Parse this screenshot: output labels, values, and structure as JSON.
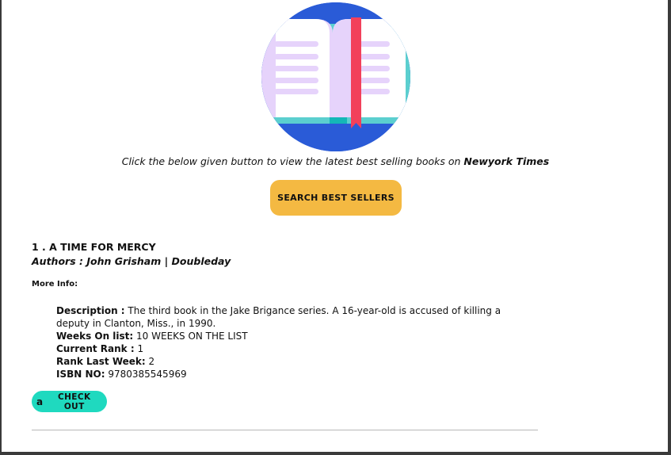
{
  "hero": {
    "icon": "open-book-icon"
  },
  "tagline": {
    "text": "Click the below given button to view the latest best selling books on ",
    "source": "Newyork Times"
  },
  "search_button": {
    "label": "SEARCH BEST SELLERS"
  },
  "books": [
    {
      "title": "1 . A TIME FOR MERCY",
      "authors": "Authors : John Grisham | Doubleday",
      "more_info_label": "More Info:",
      "description_label": "Description :",
      "description": " The third book in the Jake Brigance series. A 16-year-old is accused of killing a deputy in Clanton, Miss., in 1990.",
      "weeks_label": "Weeks On list:",
      "weeks": " 10 WEEKS ON THE LIST",
      "rank_label": "Current Rank :",
      "rank": " 1",
      "last_week_label": "Rank Last Week:",
      "last_week": " 2",
      "isbn_label": "ISBN NO:",
      "isbn": " 9780385545969",
      "checkout_icon": "a",
      "checkout_label": "CHECK OUT"
    }
  ],
  "colors": {
    "search_button": "#f4b942",
    "checkout_button": "#1fd9bf",
    "hero_circle": "#2a5bd7",
    "bookmark": "#f2405b",
    "book_pages": "#e6d3fb",
    "book_cover": "#5bcfcf"
  }
}
